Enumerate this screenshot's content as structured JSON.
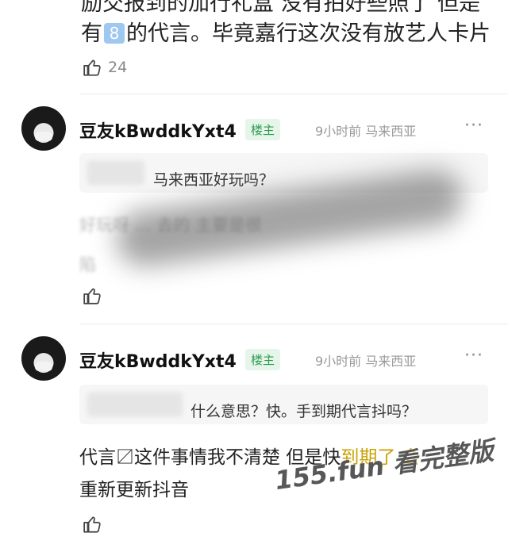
{
  "top_comment": {
    "line1": "励交报到的加行礼盒 没有拍好些照了 但是",
    "line2_a": "有",
    "line2_badge": "8",
    "line2_b": "的代言。毕竟嘉行这次没有放艺人卡片",
    "likes": "24"
  },
  "comments": [
    {
      "username": "豆友kBwddkYxt4",
      "badge": "楼主",
      "meta": "9小时前 马来西亚",
      "more": "···",
      "quote": "马来西亚好玩吗？",
      "reply_line1": "好玩呀 … 去的 主要是很",
      "reply_line2": "陷"
    },
    {
      "username": "豆友kBwddkYxt4",
      "badge": "楼主",
      "meta": "9小时前 马来西亚",
      "more": "···",
      "quote": "什么意思？快。手到期代言抖吗？",
      "reply_line1": "代言〼这件事情我不清楚 但是快",
      "reply_line1b": "到期了 会",
      "reply_line2": "重新更新抖音"
    }
  ],
  "watermark": "155.fun 看完整版"
}
